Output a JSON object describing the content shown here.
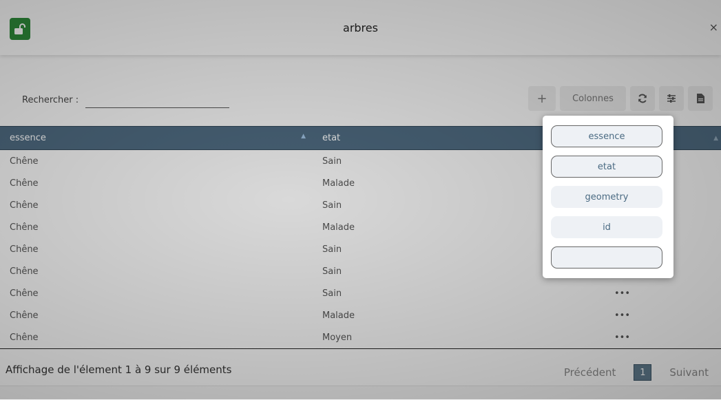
{
  "header": {
    "title": "arbres",
    "close_label": "×"
  },
  "search": {
    "label": "Rechercher :",
    "value": "",
    "placeholder": ""
  },
  "toolbar": {
    "add_label": "+",
    "columns_label": "Colonnes"
  },
  "table": {
    "headers": [
      "essence",
      "etat"
    ],
    "sort_indicator": "▲",
    "rows": [
      {
        "essence": "Chêne",
        "etat": "Sain",
        "extra": ""
      },
      {
        "essence": "Chêne",
        "etat": "Malade",
        "extra": ""
      },
      {
        "essence": "Chêne",
        "etat": "Sain",
        "extra": ""
      },
      {
        "essence": "Chêne",
        "etat": "Malade",
        "extra": ""
      },
      {
        "essence": "Chêne",
        "etat": "Sain",
        "extra": ""
      },
      {
        "essence": "Chêne",
        "etat": "Sain",
        "extra": ""
      },
      {
        "essence": "Chêne",
        "etat": "Sain",
        "extra": "•••"
      },
      {
        "essence": "Chêne",
        "etat": "Malade",
        "extra": "•••"
      },
      {
        "essence": "Chêne",
        "etat": "Moyen",
        "extra": "•••"
      }
    ]
  },
  "footer": {
    "info": "Affichage de l'élement 1 à 9 sur 9 éléments",
    "previous": "Précédent",
    "page": "1",
    "next": "Suivant"
  },
  "column_menu": {
    "items": [
      "essence",
      "etat",
      "geometry",
      "id",
      ""
    ]
  },
  "colors": {
    "lock_button": "#2e8b3a",
    "table_header": "#4e6a80",
    "page_active": "#5f7a8c"
  }
}
